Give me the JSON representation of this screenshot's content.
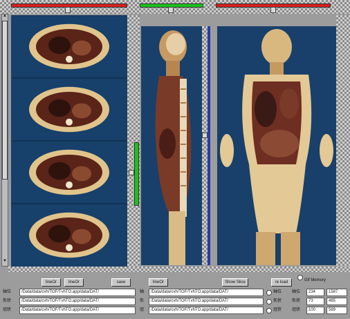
{
  "sliders": {
    "left_color": "#d42020",
    "middle_color": "#18c418",
    "right_color": "#d42020",
    "vertical_color": "#18c418",
    "left_value": 0.5,
    "middle_value": 0.5,
    "right_value": 0.5
  },
  "panels": {
    "left_axial_slices": 4,
    "background_color": "#15385c"
  },
  "buttons": {
    "b1": "lineOr",
    "b2": "lineOr",
    "b3": "save",
    "b4": "lineOr",
    "b5": "Show Slice",
    "b6": "re load"
  },
  "checkbox_label": "Gif Memory",
  "paths": {
    "row1_label": "轴位",
    "row2_label": "矢状",
    "row3_label": "冠状",
    "row1_left": "/Data/data/cvh/TOF/TvhTO.app/data/DAT/",
    "row2_left": "/Data/data/cvh/TOF/TvhTO.app/data/DAT/",
    "row3_left": "/Data/data/cvh/TOF/TvhTO.app/data/DAT/",
    "row1_right": "/Data/data/cvh/TOF/TvhTO.app/data/DAT/",
    "row2_right": "/Data/data/cvh/TOF/TvhTO.app/data/DAT/",
    "row3_right": "/Data/data/cvh/TOF/TvhTO.app/data/DAT/",
    "mid_label_1": "轴",
    "mid_label_2": "矢",
    "mid_label_3": "冠"
  },
  "radios": [
    "轴位",
    "矢状",
    "冠状"
  ],
  "coords": {
    "labels": [
      "轴位",
      "矢状",
      "冠状"
    ],
    "values_a": [
      "234",
      "73",
      "100"
    ],
    "values_b": [
      "1587",
      "465",
      "589"
    ]
  },
  "icons": {
    "scroll_up": "▲",
    "scroll_down": "▼"
  }
}
